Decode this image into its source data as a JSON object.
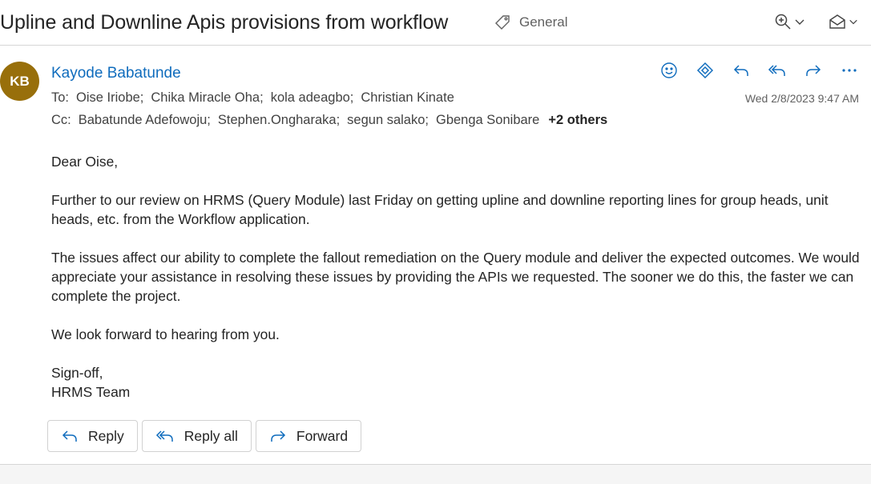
{
  "header": {
    "subject": "Upline and Downline Apis provisions from workflow",
    "sensitivity_label": "General",
    "icons": [
      "tag-icon",
      "zoom-icon",
      "chevron-down-icon",
      "mail-open-icon",
      "chevron-down-icon"
    ]
  },
  "message": {
    "avatar_initials": "KB",
    "avatar_color": "#986f0b",
    "sender_name": "Kayode Babatunde",
    "to_label": "To:",
    "to": [
      "Oise Iriobe;",
      "Chika Miracle Oha;",
      "kola adeagbo;",
      "Christian Kinate"
    ],
    "cc_label": "Cc:",
    "cc": [
      "Babatunde Adefowoju;",
      "Stephen.Ongharaka;",
      "segun salako;",
      "Gbenga Sonibare"
    ],
    "cc_more": "+2 others",
    "date": "Wed 2/8/2023 9:47 AM",
    "action_icons": [
      "emoji-icon",
      "loop-icon",
      "reply-icon",
      "reply-all-icon",
      "forward-icon",
      "more-icon"
    ]
  },
  "body": {
    "greeting": "Dear Oise,",
    "para1": "Further to our review on HRMS (Query Module) last Friday on getting upline and downline reporting lines for group heads, unit heads, etc. from the Workflow application.",
    "para2": "The issues affect our ability to complete the fallout remediation on the Query module and deliver the expected outcomes. We would appreciate your assistance in resolving these issues by providing the APIs we requested. The sooner we do this, the faster we can complete the project.",
    "para3": "We look forward to hearing from you.",
    "signoff": "Sign-off,",
    "team": "HRMS Team"
  },
  "buttons": {
    "reply": "Reply",
    "reply_all": "Reply all",
    "forward": "Forward"
  },
  "colors": {
    "accent": "#0f6cbd",
    "text": "#242424",
    "muted": "#616161"
  }
}
